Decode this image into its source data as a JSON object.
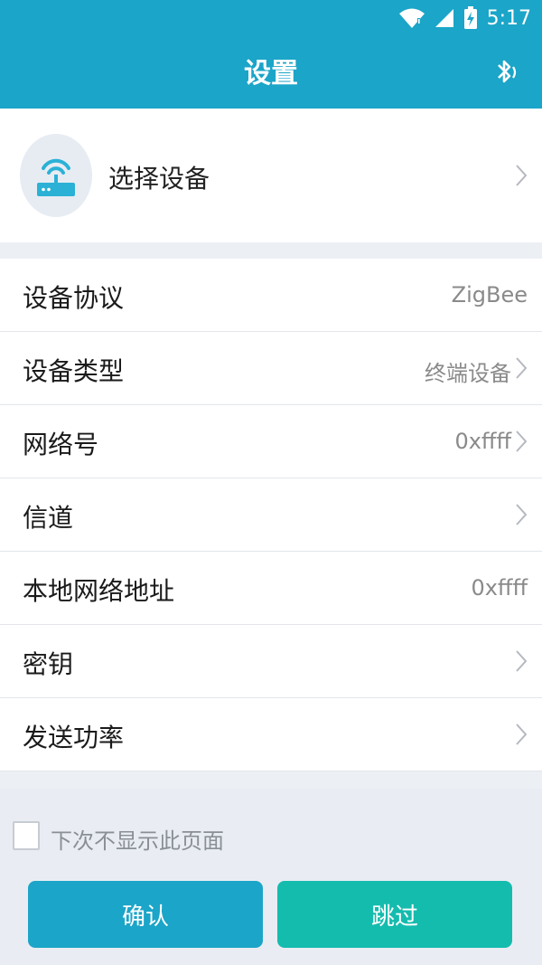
{
  "status_bar": {
    "time": "5:17",
    "icons": [
      "wifi-icon",
      "signal-icon",
      "battery-charging-icon"
    ]
  },
  "header": {
    "title": "设置",
    "action_icon": "bluetooth-icon"
  },
  "device": {
    "label": "选择设备",
    "icon": "router-icon"
  },
  "settings": [
    {
      "label": "设备协议",
      "value": "ZigBee",
      "chevron": false
    },
    {
      "label": "设备类型",
      "value": "终端设备",
      "chevron": true
    },
    {
      "label": "网络号",
      "value": "0xffff",
      "chevron": true
    },
    {
      "label": "信道",
      "value": "",
      "chevron": true
    },
    {
      "label": "本地网络地址",
      "value": "0xffff",
      "chevron": false
    },
    {
      "label": "密钥",
      "value": "",
      "chevron": true
    },
    {
      "label": "发送功率",
      "value": "",
      "chevron": true
    }
  ],
  "footer": {
    "checkbox_label": "下次不显示此页面",
    "checkbox_checked": false,
    "confirm_label": "确认",
    "skip_label": "跳过"
  },
  "colors": {
    "primary": "#1ba5c8",
    "secondary": "#14bcae",
    "background": "#eceff4"
  }
}
